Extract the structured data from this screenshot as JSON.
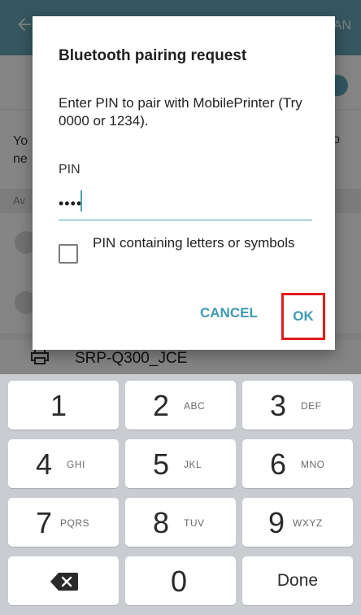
{
  "background": {
    "header_right": "AN",
    "desc_left": "Yo\nne",
    "desc_right": "o",
    "available_label": "Av",
    "device_name": "SRP-Q300_JCE"
  },
  "dialog": {
    "title": "Bluetooth pairing request",
    "message": "Enter PIN to pair with MobilePrinter (Try 0000 or 1234).",
    "pin_label": "PIN",
    "pin_value": "••••",
    "checkbox_label": "PIN containing letters or symbols",
    "cancel_label": "CANCEL",
    "ok_label": "OK"
  },
  "keypad": {
    "keys": [
      {
        "digit": "1",
        "letters": ""
      },
      {
        "digit": "2",
        "letters": "ABC"
      },
      {
        "digit": "3",
        "letters": "DEF"
      },
      {
        "digit": "4",
        "letters": "GHI"
      },
      {
        "digit": "5",
        "letters": "JKL"
      },
      {
        "digit": "6",
        "letters": "MNO"
      },
      {
        "digit": "7",
        "letters": "PQRS"
      },
      {
        "digit": "8",
        "letters": "TUV"
      },
      {
        "digit": "9",
        "letters": "WXYZ"
      },
      {
        "digit": "0",
        "letters": ""
      }
    ],
    "done_label": "Done"
  },
  "colors": {
    "accent": "#3f9ab3",
    "highlight": "#e21b1b",
    "header": "#66a7b6"
  }
}
